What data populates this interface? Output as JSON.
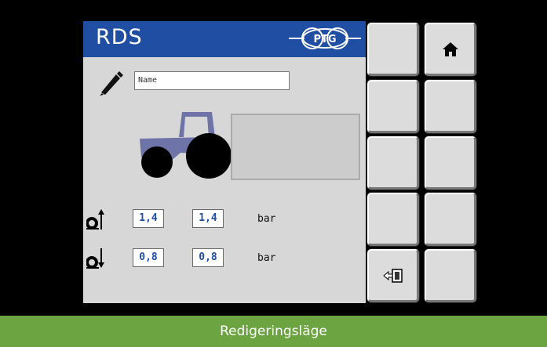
{
  "header": {
    "title": "RDS",
    "logo_text": "PTG"
  },
  "name_field": {
    "value": "Name",
    "icon": "pencil-icon"
  },
  "pressures": {
    "upper": {
      "icon": "tire-up-arrow-icon",
      "front": "1,4",
      "rear": "1,4",
      "unit": "bar"
    },
    "lower": {
      "icon": "tire-down-arrow-icon",
      "front": "0,8",
      "rear": "0,8",
      "unit": "bar"
    }
  },
  "softkeys": {
    "home_icon": "home-icon",
    "exit_icon": "exit-icon"
  },
  "status": {
    "text": "Redigeringsläge"
  },
  "colors": {
    "header": "#1f4ea3",
    "status": "#6ca441",
    "tractor_body": "#6e73a8",
    "value_text": "#1f4ea3"
  }
}
